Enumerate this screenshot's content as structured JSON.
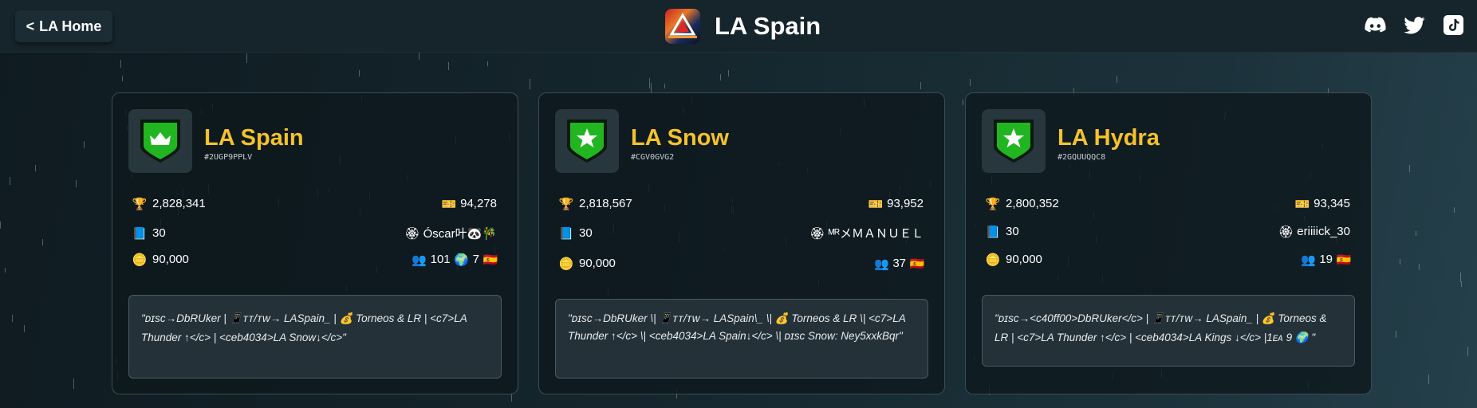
{
  "header": {
    "home_label": "LA Home",
    "home_chevron": "<",
    "title": "LA Spain",
    "socials": [
      "discord-icon",
      "twitter-icon",
      "tiktok-icon"
    ]
  },
  "clubs": [
    {
      "name": "LA Spain",
      "tag": "#2UGP9PPLV",
      "badge": "crown",
      "trophies": "2,828,341",
      "required_trophies": "94,278",
      "members": "30",
      "president": "Óscar叶🐼🎋",
      "required": "90,000",
      "online": "101",
      "region_count": "7",
      "description": "\"ᴅɪsᴄ→DbRUker | 📱ᴛᴛ/ᴛᴡ→ LASpain_ | 💰 Torneos & LR | <c7>LA Thunder ↑</c> | <ceb4034>LA Snow↓</c>\""
    },
    {
      "name": "LA Snow",
      "tag": "#CGV0GVG2",
      "badge": "star",
      "trophies": "2,818,567",
      "required_trophies": "93,952",
      "members": "30",
      "president": "ᴹᴿメＭＡＮＵＥＬ",
      "required": "90,000",
      "online": "37",
      "region_count": "",
      "description": "\"ᴅɪsᴄ→DbRUker \\| 📱ᴛᴛ/ᴛᴡ→ LASpain\\_ \\| 💰 Torneos & LR \\| <c7>LA Thunder ↑</c> \\| <ceb4034>LA Spain↓</c> \\| ᴅɪsᴄ Snow: Ney5xxkBqr\""
    },
    {
      "name": "LA Hydra",
      "tag": "#2GQUUQQC8",
      "badge": "star",
      "trophies": "2,800,352",
      "required_trophies": "93,345",
      "members": "30",
      "president": "eriiiick_30",
      "required": "90,000",
      "online": "19",
      "region_count": "",
      "description": "\"ᴅɪsᴄ→<c40ff00>DbRUker</c> | 📱ᴛᴛ/ᴛᴡ→ LASpain_ | 💰 Torneos & LR | <c7>LA Thunder ↑</c> | <ceb4034>LA Kings ↓</c> |1ᴇᴀ 9 🌍 \""
    }
  ],
  "colors": {
    "accent_gold": "#f4c22b",
    "badge_green": "#21b521",
    "background": "#15262d"
  }
}
